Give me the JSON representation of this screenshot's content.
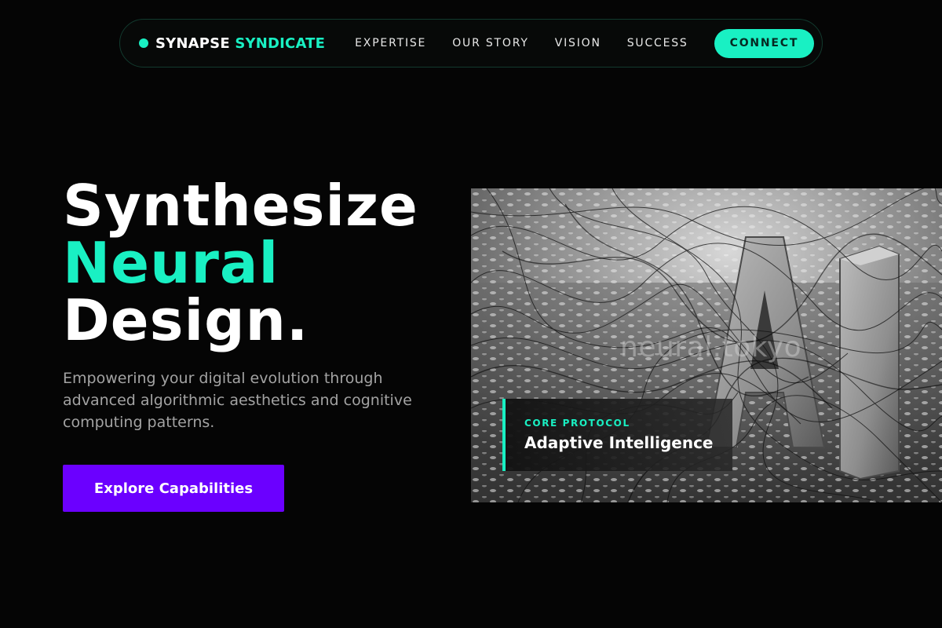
{
  "brand": {
    "name_primary": "SYNAPSE",
    "name_accent": "SYNDICATE"
  },
  "nav": {
    "links": [
      "EXPERTISE",
      "OUR STORY",
      "VISION",
      "SUCCESS"
    ],
    "cta_label": "CONNECT"
  },
  "hero": {
    "title_line1": "Synthesize",
    "title_line2": "Neural",
    "title_line3": "Design.",
    "subtitle": "Empowering your digital evolution through advanced algorithmic aesthetics and cognitive computing patterns.",
    "cta_label": "Explore Capabilities"
  },
  "visual": {
    "watermark": "neural.tokyo",
    "card_kicker": "CORE PROTOCOL",
    "card_title": "Adaptive Intelligence"
  },
  "colors": {
    "background": "#050505",
    "accent": "#19f0c3",
    "cta": "#6b00ff",
    "muted_text": "#a3a3a3"
  }
}
